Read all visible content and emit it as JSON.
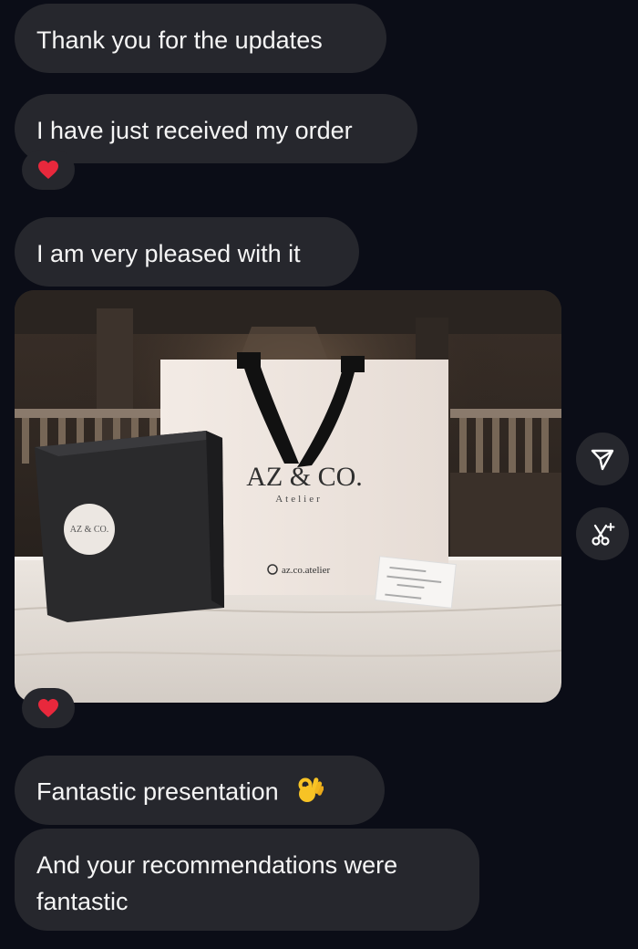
{
  "messages": [
    {
      "text": "Thank you for the updates"
    },
    {
      "text": "I have just received my order",
      "reaction": "heart-icon"
    },
    {
      "text": "I am very pleased with it"
    },
    {
      "text": "Fantastic presentation",
      "emoji": "ok-hand-emoji"
    },
    {
      "text": "And your recommendations were fantastic"
    }
  ],
  "photo": {
    "bag_brand": "AZ & CO.",
    "bag_subbrand": "Atelier",
    "bag_handle": "az.co.atelier",
    "box_sticker": "AZ & CO.",
    "reaction": "heart-icon"
  },
  "side_actions": [
    "share-icon",
    "magic-cut-icon"
  ],
  "colors": {
    "background": "#0b0d17",
    "bubble": "#26272d",
    "text": "#f5f5f5",
    "heart": "#e8283c"
  }
}
